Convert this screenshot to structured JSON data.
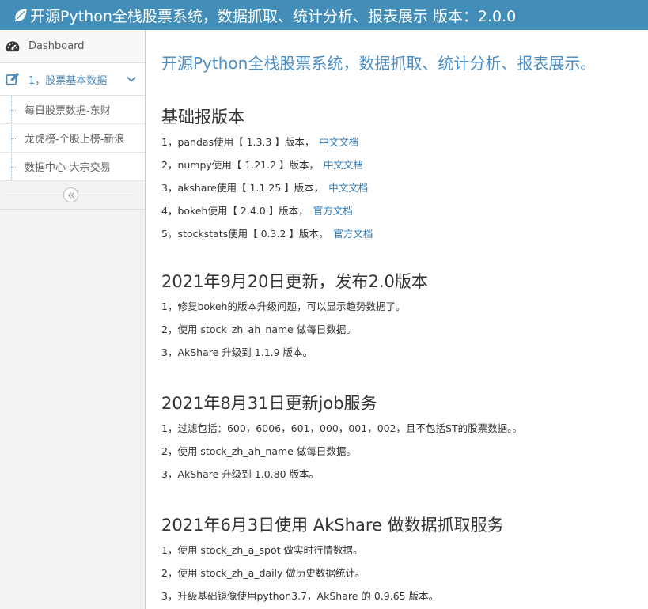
{
  "header": {
    "title": "开源Python全栈股票系统，数据抓取、统计分析、报表展示 版本：2.0.0"
  },
  "sidebar": {
    "dashboard_label": "Dashboard",
    "group_label": "1，股票基本数据",
    "items": [
      {
        "label": "每日股票数据-东财"
      },
      {
        "label": "龙虎榜-个股上榜-新浪"
      },
      {
        "label": "数据中心-大宗交易"
      }
    ],
    "collapse_glyph": "«"
  },
  "main": {
    "page_title": "开源Python全栈股票系统，数据抓取、统计分析、报表展示。",
    "sections": [
      {
        "title": "基础报版本",
        "lines": [
          {
            "text": "1，pandas使用【 1.3.3 】版本，",
            "link": "中文文档"
          },
          {
            "text": "2，numpy使用【 1.21.2 】版本，",
            "link": "中文文档"
          },
          {
            "text": "3，akshare使用【 1.1.25 】版本，",
            "link": "中文文档"
          },
          {
            "text": "4，bokeh使用【 2.4.0 】版本，",
            "link": "官方文档"
          },
          {
            "text": "5，stockstats使用【 0.3.2 】版本，",
            "link": "官方文档"
          }
        ]
      },
      {
        "title": "2021年9月20日更新，发布2.0版本",
        "lines": [
          {
            "text": "1，修复bokeh的版本升级问题，可以显示趋势数据了。"
          },
          {
            "text": "2，使用 stock_zh_ah_name 做每日数据。"
          },
          {
            "text": "3，AkShare 升级到 1.1.9 版本。"
          }
        ]
      },
      {
        "title": "2021年8月31日更新job服务",
        "lines": [
          {
            "text": "1，过滤包括：600，6006，601，000，001，002，且不包括ST的股票数据。。"
          },
          {
            "text": "2，使用 stock_zh_ah_name 做每日数据。"
          },
          {
            "text": "3，AkShare 升级到 1.0.80 版本。"
          }
        ]
      },
      {
        "title": "2021年6月3日使用 AkShare 做数据抓取服务",
        "lines": [
          {
            "text": "1，使用 stock_zh_a_spot 做实时行情数据。"
          },
          {
            "text": "2，使用 stock_zh_a_daily 做历史数据统计。"
          },
          {
            "text": "3，升级基础镜像使用python3.7，AkShare 的 0.9.65 版本。"
          }
        ]
      }
    ]
  },
  "colors": {
    "header_bg": "#438eb9",
    "accent_blue": "#4a8ec5",
    "link_blue": "#2a7ab8",
    "sidebar_bg": "#f2f2f2"
  }
}
